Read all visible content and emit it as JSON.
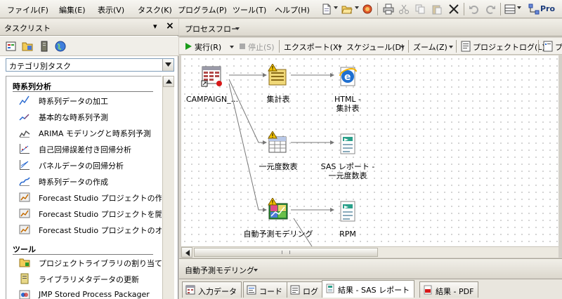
{
  "menubar": {
    "items": [
      "ファイル(F)",
      "編集(E)",
      "表示(V)",
      "タスク(K)",
      "プログラム(P)",
      "ツール(T)",
      "ヘルプ(H)"
    ],
    "tools": [
      "new-icon",
      "open-icon",
      "import-icon",
      "print-icon",
      "cut-icon",
      "copy-icon",
      "paste-icon",
      "delete-icon",
      "undo-icon",
      "redo-icon",
      "layout-icon",
      "project-icon"
    ],
    "trailing_label": "Pro"
  },
  "task_panel": {
    "title": "タスクリスト",
    "pin_symbol": "▾",
    "close_symbol": "×",
    "toolbar_icons": [
      "task-view-icon",
      "folder-icon",
      "server-icon",
      "globe-icon"
    ],
    "dropdown_value": "カテゴリ別タスク",
    "categories": [
      {
        "title": "時系列分析",
        "items": [
          "時系列データの加工",
          "基本的な時系列予測",
          "ARIMA モデリングと時系列予測",
          "自己回帰誤差付き回帰分析",
          "パネルデータの回帰分析",
          "時系列データの作成",
          "Forecast Studio プロジェクトの作成",
          "Forecast Studio プロジェクトを開く",
          "Forecast Studio プロジェクトのオーバ"
        ]
      },
      {
        "title": "ツール",
        "items": [
          "プロジェクトライブラリの割り当て",
          "ライブラリメタデータの更新",
          "JMP Stored Process Packager"
        ]
      }
    ]
  },
  "flow_pane": {
    "title": "プロセスフロー",
    "toolbar": {
      "run": "実行(R)",
      "stop": "停止(S)",
      "export": "エクスポート(X)",
      "schedule": "スケジュール(D)",
      "zoom": "ズーム(Z)",
      "project_log": "プロジェクトログ(L)",
      "trailing": "プ"
    },
    "nodes": {
      "campaign": "CAMPAIGN_...",
      "summary": "集計表",
      "html_line1": "HTML -",
      "html_line2": "集計表",
      "oneway": "一元度数表",
      "sas_line1": "SAS レポート -",
      "sas_line2": "一元度数表",
      "automod": "自動予測モデリング",
      "rpm": "RPM"
    },
    "bottom_title": "自動予測モデリング",
    "tabs": [
      {
        "label": "入力データ",
        "icon": "table-icon",
        "active": false
      },
      {
        "label": "コード",
        "icon": "code-icon",
        "active": false
      },
      {
        "label": "ログ",
        "icon": "log-icon",
        "active": false
      },
      {
        "label": "結果 - SAS レポート",
        "icon": "report-icon",
        "active": true
      },
      {
        "label": "結果 - PDF",
        "icon": "pdf-icon",
        "active": false
      }
    ]
  },
  "colors": {
    "warning": "#f2c200",
    "run_green": "#1a9c1a",
    "ie_blue": "#1e6fd0",
    "sas_teal": "#2aa08a"
  }
}
